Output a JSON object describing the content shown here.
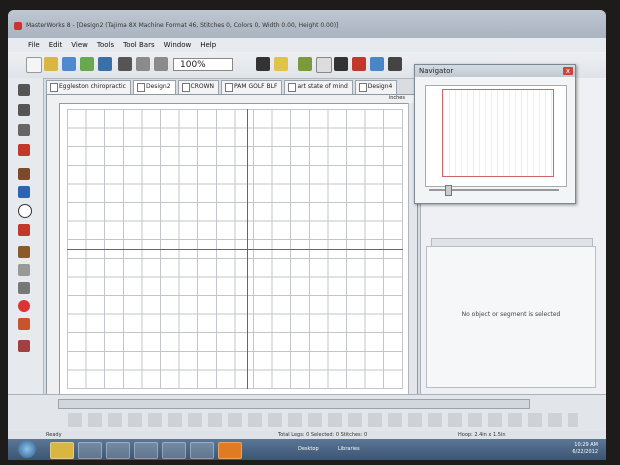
{
  "window": {
    "title": "MasterWorks 8 - [Design2 (Tajima 8X Machine Format 46, Stitches 0, Colors 0, Width 0.00, Height 0.00)]"
  },
  "menu": [
    "File",
    "Edit",
    "View",
    "Tools",
    "Tool Bars",
    "Window",
    "Help"
  ],
  "toolbar": {
    "zoom_value": "100%"
  },
  "tabs": [
    "Eggleston chiropractic",
    "Design2",
    "CROWN",
    "PAM GOLF BLF",
    "art state of mind",
    "Design4"
  ],
  "ruler": {
    "units": "inches"
  },
  "navigator": {
    "title": "Navigator",
    "close": "x"
  },
  "properties": {
    "empty_message": "No object or segment is selected"
  },
  "status": {
    "ready": "Ready",
    "center": "Total Legs: 0  Selected: 0  Stitches: 0",
    "right": "Hoop: 2.4in x 1.5in"
  },
  "taskbar": {
    "desktop": "Desktop",
    "libraries": "Libraries",
    "time": "10:29 AM",
    "date": "6/22/2012"
  },
  "colors": {
    "accent": "#c9463d",
    "taskbar": "#3b5572"
  }
}
